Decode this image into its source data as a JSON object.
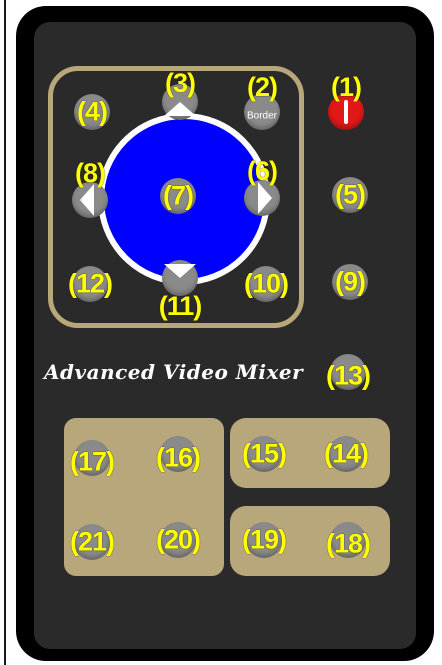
{
  "brand": {
    "title": "Advanced Video Mixer"
  },
  "buttons": {
    "b1": {
      "num": "(1)"
    },
    "b2": {
      "num": "(2)",
      "label": "Border"
    },
    "b3": {
      "num": "(3)"
    },
    "b4": {
      "num": "(4)"
    },
    "b5": {
      "num": "(5)"
    },
    "b6": {
      "num": "(6)"
    },
    "b7": {
      "num": "(7)"
    },
    "b8": {
      "num": "(8)"
    },
    "b9": {
      "num": "(9)"
    },
    "b10": {
      "num": "(10)"
    },
    "b11": {
      "num": "(11)"
    },
    "b12": {
      "num": "(12)"
    },
    "b13": {
      "num": "(13)"
    },
    "b14": {
      "num": "(14)"
    },
    "b15": {
      "num": "(15)"
    },
    "b16": {
      "num": "(16)"
    },
    "b17": {
      "num": "(17)"
    },
    "b18": {
      "num": "(18)"
    },
    "b19": {
      "num": "(19)"
    },
    "b20": {
      "num": "(20)"
    },
    "b21": {
      "num": "(21)"
    }
  },
  "colors": {
    "dpad": "#0000ff",
    "accent_panel": "#b7a77a",
    "button": "#8a8a8a",
    "power": "#e01818",
    "number_label": "#ffff00"
  }
}
